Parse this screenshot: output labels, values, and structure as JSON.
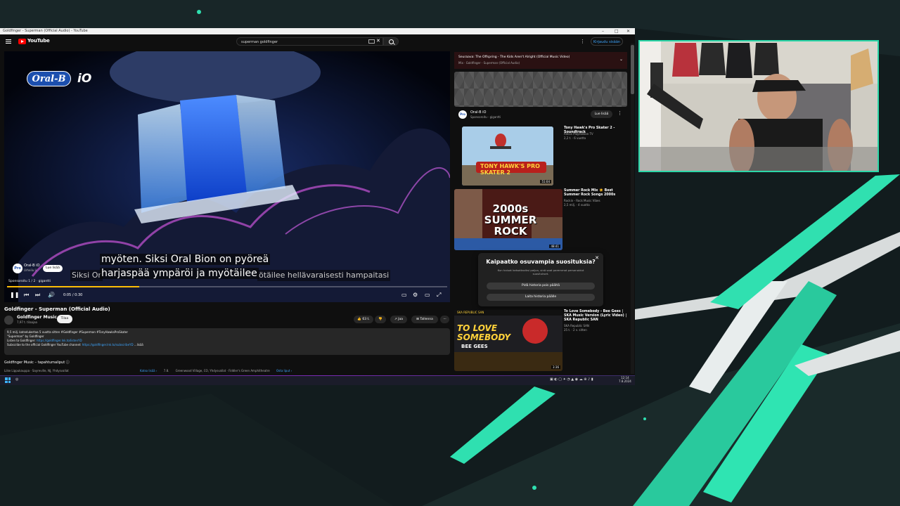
{
  "window": {
    "title": "Goldfinger - Superman (Official Audio) - YouTube",
    "controls": [
      "–",
      "□",
      "✕"
    ]
  },
  "youtube": {
    "logo_text": "YouTube",
    "search_value": "superman goldfinger",
    "clear_icon": "close-icon",
    "signin_label": "Kirjaudu sisään"
  },
  "player": {
    "brand_logo": "Oral-B",
    "brand_model": "iO",
    "caption_line1": "myöten. Siksi Oral Bion on pyöreä",
    "caption_line2a": "Siksi Or",
    "caption_line2b": "harjaspää ympäröi ja myötäilee",
    "caption_line2c": "ötäilee hellävaraisesti hampaitasi",
    "ad_channel_name": "Oral-B iO",
    "ad_channel_sub": "Urheilu li",
    "ad_avatar": "Pro",
    "ad_button": "Lue lisää",
    "ad_meta_left": "Sponsoroitu 1 / 2",
    "ad_meta_right": "gigantti",
    "time": "0:05 / 0:30",
    "progress": 0.3
  },
  "video": {
    "title": "Goldfinger - Superman (Official Audio)",
    "channel": "Goldfinger Music",
    "subscribers": "7,97 t. tilaajaa",
    "subscribe_label": "Tilaa",
    "likes": "63 t.",
    "share_label": "Jaa",
    "save_label": "Tallenna",
    "more_label": "···"
  },
  "description": {
    "line1": "9,5 milj. katselukertaa  5 vuotta sitten  #Goldfinger #Superman #TonyHawksProSkater",
    "line2": "\"Superman\" by Goldfinger",
    "line3_prefix": "Listen to Goldfinger: ",
    "line3_link": "https://goldfinger.lnk.to/listenYD",
    "line4_prefix": "Subscribe to the official Goldfinger YouTube channel: ",
    "line4_link": "https://goldfinger.lnk.to/subscribeYD",
    "more": "...lisää"
  },
  "merch": {
    "heading": "Goldfinger Music – tapahtumaliput",
    "row_left": "Liike  Lippukauppa · Sayreville, NJ, Yhdysvallat",
    "row_mid_link": "Katso lisää ›",
    "row_date": "7.8.",
    "row_place": "Greenwood Village, CO, Yhdysvallat  ·  Fiddler's Green Amphitheatre",
    "row_link2": "Osta liput ›"
  },
  "sidebar": {
    "now_playing_title": "Seuraava: The Offspring - The Kids Aren't Alright (Official Music Video)",
    "now_playing_sub": "Mix · Goldfinger - Superman (Official Audio)",
    "ad_name": "Oral-B iO",
    "ad_sub": "Sponsoroitu · gigantti",
    "ad_avatar": "Pro",
    "ad_button": "Lue lisää",
    "recs": [
      {
        "title": "Tony Hawk's Pro Skater 2 - Soundtrack",
        "channel": "Alexis Playstation TV",
        "meta": "2,2 t. · 6 vuotta",
        "duration": "51:04",
        "thumb_text": "TONY HAWK'S PRO SKATER 2"
      },
      {
        "title": "Summer Rock Mix ☀️ Best Summer Rock Songs 2000s",
        "channel": "Rockin - Rock Music Vibes",
        "meta": "2,5 milj. · 4 vuotta",
        "duration": "48:41",
        "thumb_text": "2000s SUMMER ROCK"
      },
      {
        "title": "To Love Somebody - Bee Gees | SKA Music Version (Lyric Video) | SKA Republic SAN",
        "channel": "SKA Republic SAN",
        "meta": "25 t. · 2 v. sitten",
        "duration": "3:36",
        "thumb_text": "TO LOVE SOMEBODY",
        "thumb_sub": "BEE GEES",
        "thumb_tag": "SKA REPUBLIC SAN"
      }
    ],
    "popup": {
      "title": "Kaipaatko osuvampia suosituksia?",
      "body": "Kun haluat katsottaviksi paljon, sinä saat paremmat personoidut suositukset.",
      "btn1": "Pidä historia pois päältä",
      "btn2": "Laita historia päälle",
      "close": "✕"
    }
  },
  "taskbar": {
    "time": "12:14",
    "date": "7.8.2024"
  },
  "colors": {
    "accent_teal": "#2cd7a8",
    "yt_red": "#ff0000",
    "progress_ad": "#fbbd07",
    "link_blue": "#3ea6ff"
  }
}
